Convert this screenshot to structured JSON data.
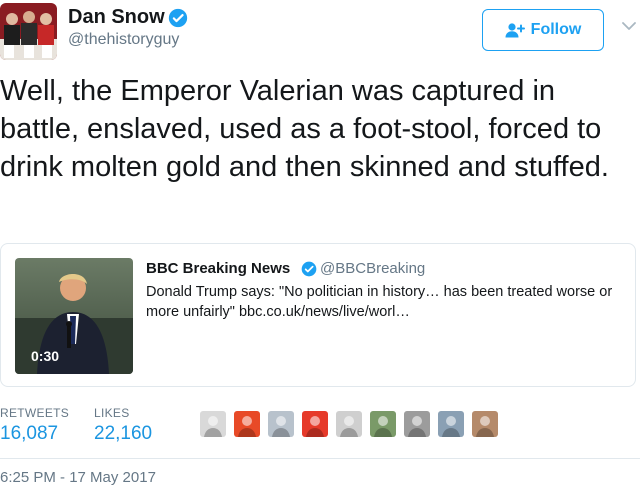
{
  "author": {
    "name": "Dan Snow",
    "handle": "@thehistoryguy",
    "avatar_icon": "group-photo-avatar",
    "verified": true
  },
  "follow_button": {
    "label": "Follow",
    "icon": "add-user-icon"
  },
  "menu_icon": "chevron-down-icon",
  "tweet": {
    "text": "Well, the Emperor Valerian was captured in battle, enslaved, used as a foot-stool, forced to drink molten gold and then skinned and stuffed."
  },
  "quoted": {
    "name": "BBC Breaking News",
    "handle": "@BBCBreaking",
    "verified": true,
    "text": "Donald Trump says:  \"No politician in history… has been treated worse or more unfairly\" bbc.co.uk/news/live/worl…",
    "video_duration": "0:30",
    "thumbnail_icon": "speaker-at-podium-thumbnail"
  },
  "stats": {
    "retweets_label": "RETWEETS",
    "retweets_value": "16,087",
    "likes_label": "LIKES",
    "likes_value": "22,160"
  },
  "likers": [
    {
      "name": "liker-avatar-1",
      "color": "#d9d9d9"
    },
    {
      "name": "liker-avatar-2",
      "color": "#e84a27"
    },
    {
      "name": "liker-avatar-3",
      "color": "#b8c2cc"
    },
    {
      "name": "liker-avatar-4",
      "color": "#e63a2a"
    },
    {
      "name": "liker-avatar-5",
      "color": "#cfcfcf"
    },
    {
      "name": "liker-avatar-6",
      "color": "#7a9a68"
    },
    {
      "name": "liker-avatar-7",
      "color": "#9c9c9c"
    },
    {
      "name": "liker-avatar-8",
      "color": "#8aa0b4"
    },
    {
      "name": "liker-avatar-9",
      "color": "#b58a6a"
    }
  ],
  "timestamp": "6:25 PM - 17 May 2017",
  "colors": {
    "accent": "#1da1f2",
    "stat_value": "#1b95e0",
    "muted": "#657786",
    "border": "#e1e8ed"
  }
}
